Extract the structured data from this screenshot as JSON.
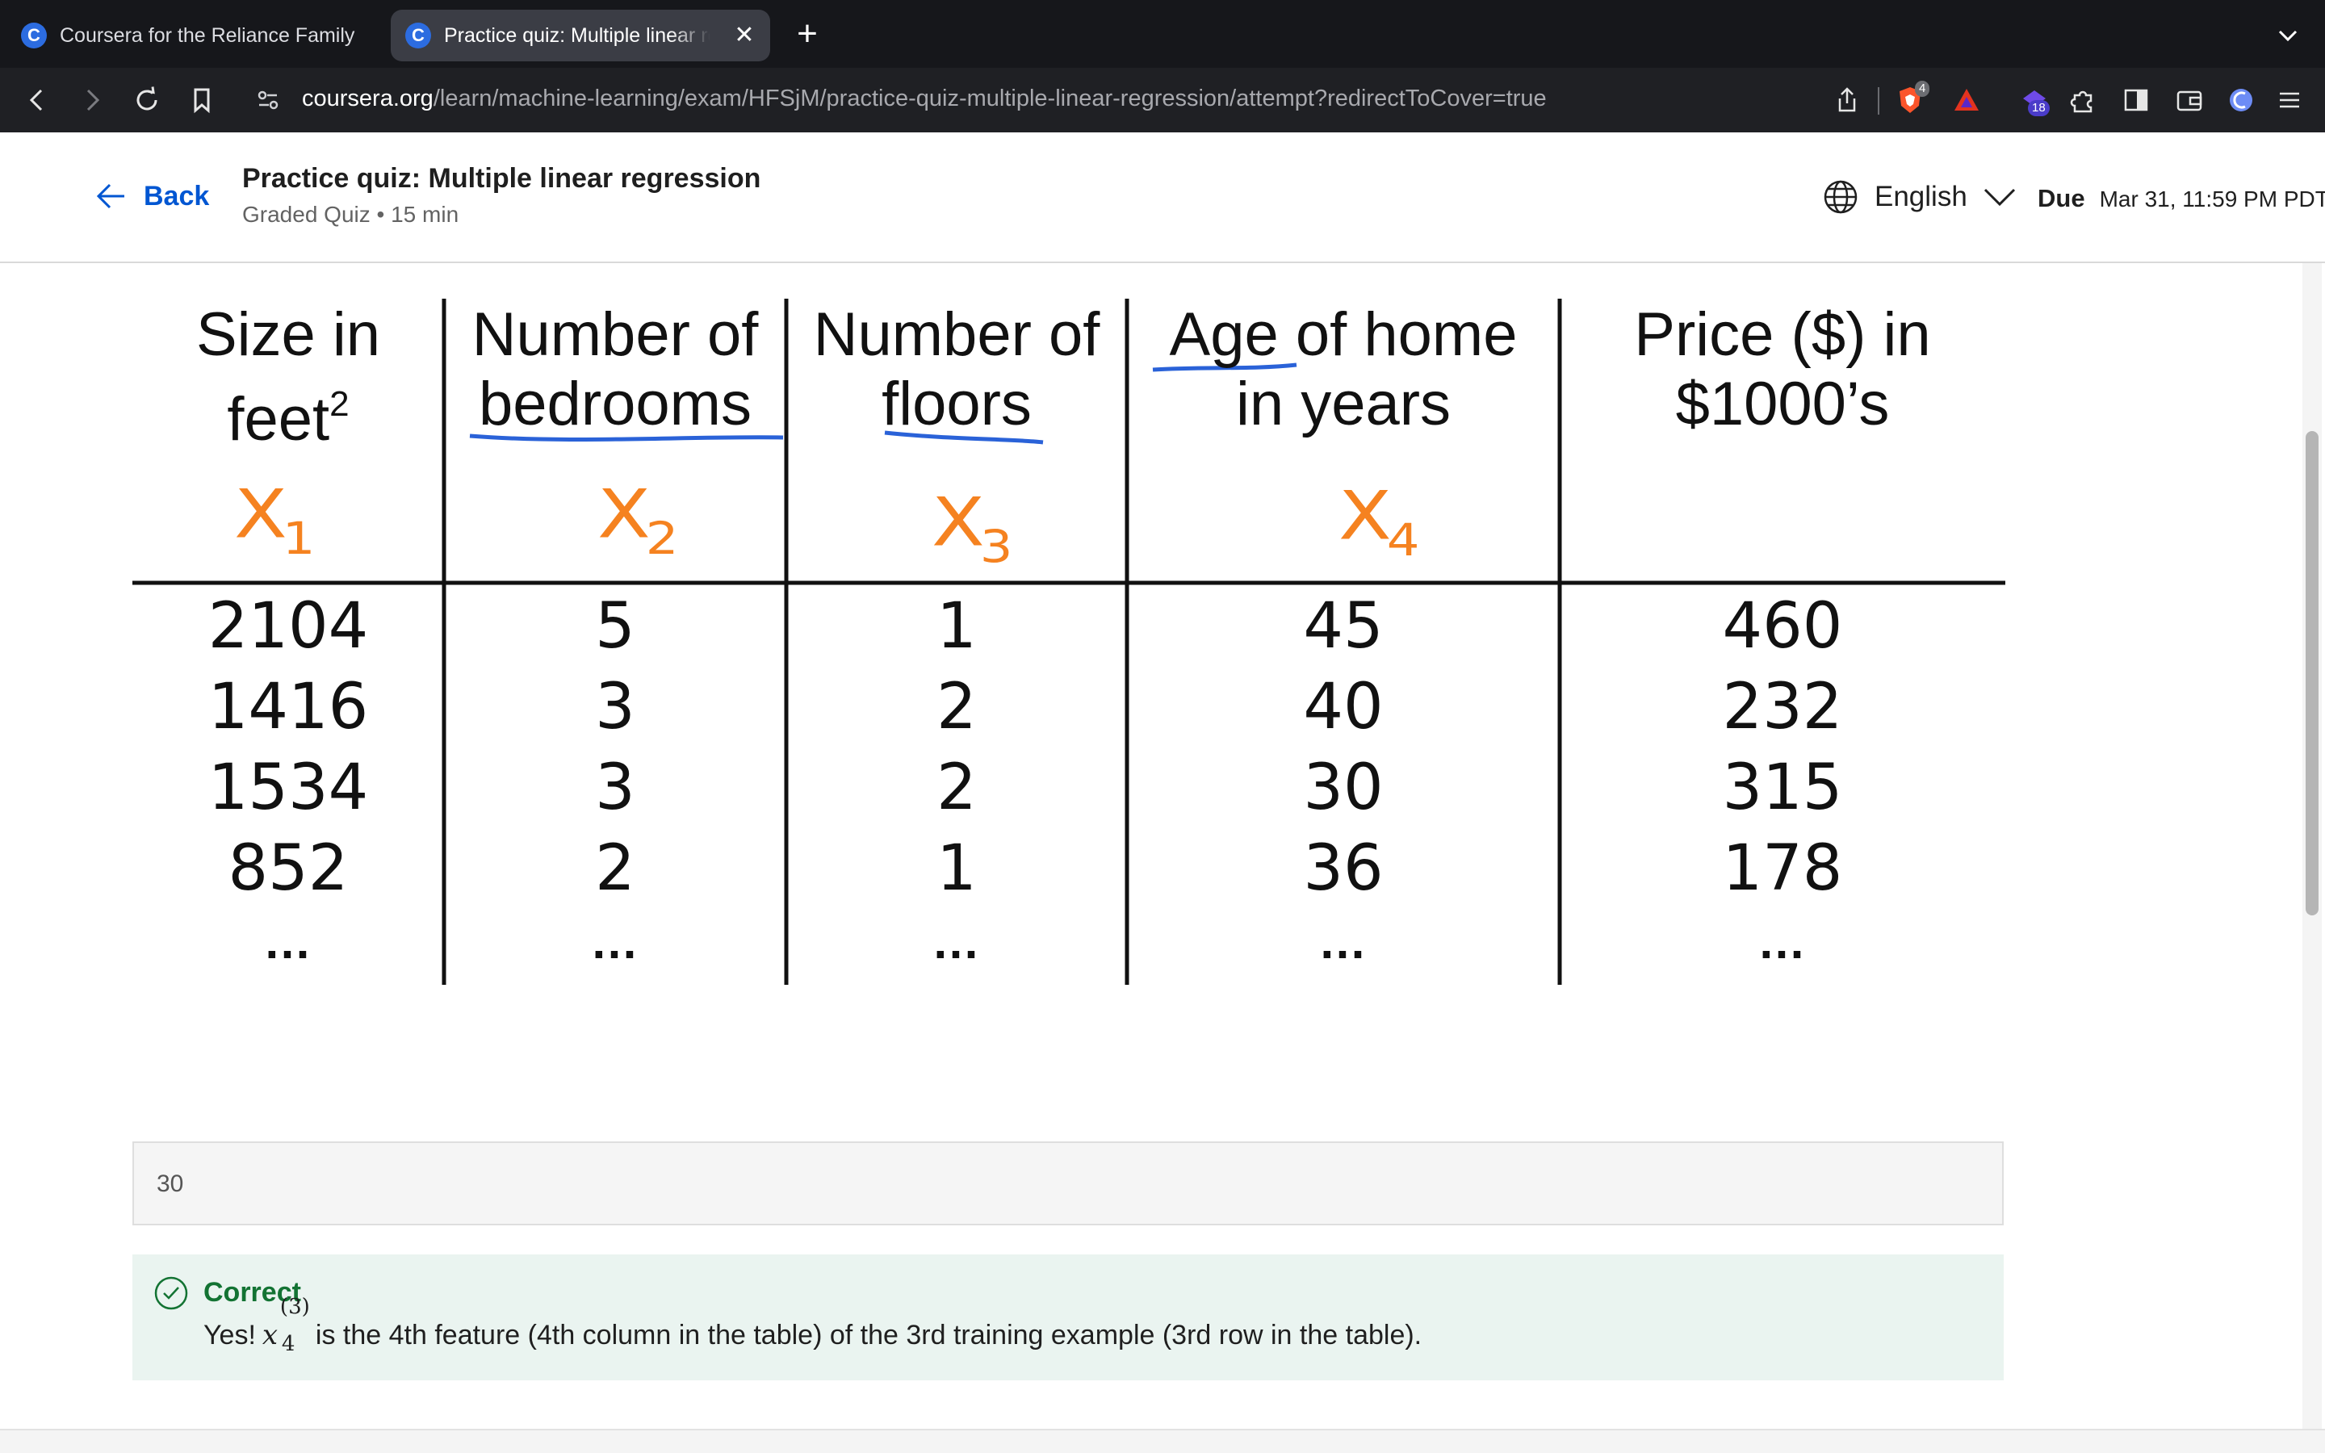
{
  "browser": {
    "tabs": [
      {
        "title": "Coursera for the Reliance Family |",
        "favicon": "C",
        "active": false
      },
      {
        "title": "Practice quiz: Multiple linear regression",
        "favicon": "C",
        "active": true
      }
    ],
    "close_tab_symbol": "✕",
    "new_tab_symbol": "+",
    "url_domain": "coursera.org",
    "url_path": "/learn/machine-learning/exam/HFSjM/practice-quiz-multiple-linear-regression/attempt?redirectToCover=true",
    "brave_badge": "4",
    "wallet_badge": "18",
    "icons": [
      "back-arrow",
      "forward-arrow",
      "reload",
      "bookmark",
      "site-settings",
      "share",
      "brave-shields",
      "brave-rewards",
      "leo-ai",
      "extensions",
      "sidebar",
      "wallet",
      "vpn",
      "menu",
      "tab-list-chevron"
    ]
  },
  "header": {
    "back_label": "Back",
    "title": "Practice quiz: Multiple linear regression",
    "subtitle": "Graded Quiz • 15 min",
    "language": "English",
    "due_label": "Due",
    "due_date": "Mar 31, 11:59 PM PDT"
  },
  "table": {
    "headers": [
      {
        "line1": "Size in",
        "line2": "feet",
        "sup": "2"
      },
      {
        "line1": "Number of",
        "line2": "bedrooms"
      },
      {
        "line1": "Number of",
        "line2": "floors"
      },
      {
        "line1": "Age of home",
        "line2": "in years"
      },
      {
        "line1": "Price ($) in",
        "line2": "$1000’s"
      }
    ],
    "features": [
      {
        "base": "X",
        "sub": "1"
      },
      {
        "base": "X",
        "sub": "2"
      },
      {
        "base": "X",
        "sub": "3"
      },
      {
        "base": "X",
        "sub": "4"
      }
    ],
    "rows": [
      [
        "2104",
        "5",
        "1",
        "45",
        "460"
      ],
      [
        "1416",
        "3",
        "2",
        "40",
        "232"
      ],
      [
        "1534",
        "3",
        "2",
        "30",
        "315"
      ],
      [
        "852",
        "2",
        "1",
        "36",
        "178"
      ]
    ],
    "ellipsis": "…",
    "underline_color": "#2a62d8",
    "feature_color": "#f58220"
  },
  "answer": {
    "value": "30"
  },
  "feedback": {
    "title": "Correct",
    "prefix": "Yes!",
    "math_base": "x",
    "math_sup": "(3)",
    "math_sub": "4",
    "text": "is the 4th feature (4th column in the table) of the 3rd training example (3rd row in the table).",
    "color": "#137333"
  }
}
